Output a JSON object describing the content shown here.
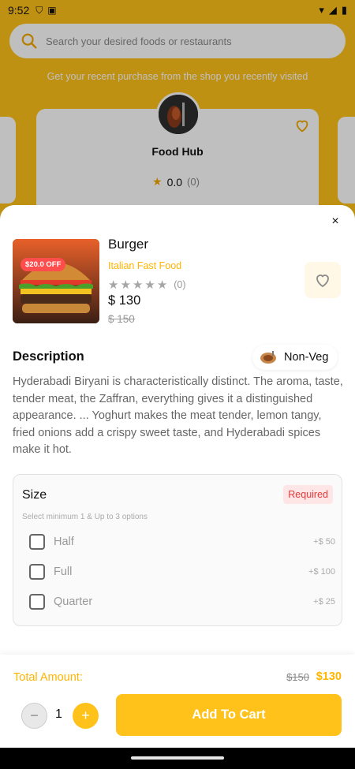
{
  "status_bar": {
    "time": "9:52"
  },
  "background": {
    "search_placeholder": "Search your desired foods or restaurants",
    "subtitle": "Get your recent purchase from the shop you recently visited",
    "store": {
      "name": "Food Hub",
      "rating": "0.0",
      "review_count": "(0)"
    }
  },
  "sheet": {
    "close_symbol": "×",
    "product": {
      "name": "Burger",
      "category": "Italian Fast Food",
      "discount_badge": "$20.0 OFF",
      "rating_count": "(0)",
      "stars_filled": 0,
      "stars_total": 5,
      "price": "$ 130",
      "old_price": "$ 150"
    },
    "description": {
      "title": "Description",
      "veg_label": "Non-Veg",
      "text": "Hyderabadi Biryani is characteristically distinct. The aroma, taste, tender meat, the Zaffran, everything gives it a distinguished appearance. ... Yoghurt makes the meat tender, lemon tangy, fried onions add a crispy sweet taste, and Hyderabadi spices make it hot."
    },
    "size": {
      "title": "Size",
      "required_label": "Required",
      "hint": "Select minimum 1 & Up to 3 options",
      "options": [
        {
          "label": "Half",
          "price": "+$ 50",
          "checked": false
        },
        {
          "label": "Full",
          "price": "+$ 100",
          "checked": false
        },
        {
          "label": "Quarter",
          "price": "+$ 25",
          "checked": false
        }
      ]
    }
  },
  "footer": {
    "total_label": "Total Amount:",
    "total_old": "$150",
    "total_new": "$130",
    "quantity": "1",
    "minus_symbol": "−",
    "plus_symbol": "+",
    "add_to_cart": "Add To Cart"
  },
  "colors": {
    "accent": "#ffc21a",
    "accent_text": "#ffb400",
    "danger": "#e03b3b",
    "discount": "#ff4d4d"
  }
}
